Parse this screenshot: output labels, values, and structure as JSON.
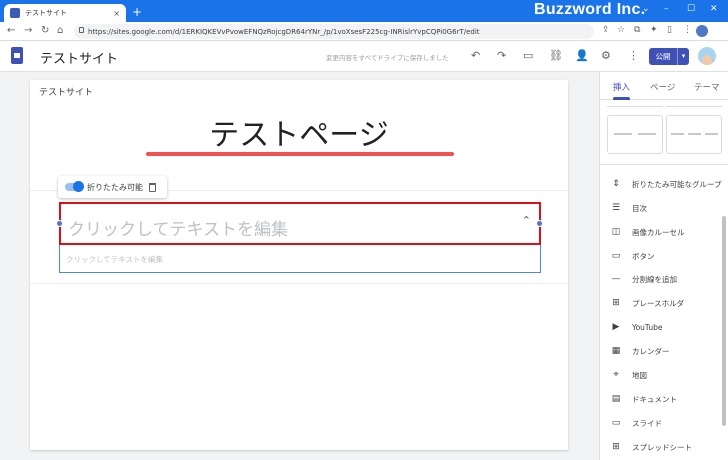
{
  "browser": {
    "tab_title": "テストサイト",
    "tab_close": "×",
    "new_tab": "+",
    "brand": "Buzzword Inc.",
    "window_controls": [
      "⌄",
      "–",
      "☐",
      "✕"
    ],
    "back": "←",
    "forward": "→",
    "reload": "↻",
    "home": "⌂",
    "url": "https://sites.google.com/d/1ERKIQKEVvPvowEFNQzRojcgDR64rYNr_/p/1voXsesF225cg-INRislrYvpCQPi0G6rT/edit",
    "toolbar_right_icons": [
      "⇪",
      "☆",
      "⧉",
      "✦",
      "▯"
    ],
    "menu": "⋮"
  },
  "appbar": {
    "site_name": "テストサイト",
    "save_status": "変更内容をすべてドライブに保存しました",
    "undo": "↶",
    "redo": "↷",
    "preview": "▭",
    "link": "⛓",
    "share": "👤",
    "settings": "⚙",
    "more": "⋮",
    "publish_label": "公開",
    "publish_dropdown": "▾"
  },
  "page": {
    "site_label": "テストサイト",
    "title": "テストページ",
    "chip_label": "折りたたみ可能",
    "collapse_header_placeholder": "クリックしてテキストを編集",
    "collapse_chevron": "⌃",
    "collapse_body_placeholder": "クリックしてテキストを編集"
  },
  "panel": {
    "tabs": [
      "挿入",
      "ページ",
      "テーマ"
    ],
    "active_tab": "挿入",
    "items": [
      {
        "icon": "collapsible-group-icon",
        "glyph": "⇕",
        "label": "折りたたみ可能なグループ"
      },
      {
        "icon": "toc-icon",
        "glyph": "☰",
        "label": "目次"
      },
      {
        "icon": "carousel-icon",
        "glyph": "◫",
        "label": "画像カルーセル"
      },
      {
        "icon": "button-icon",
        "glyph": "▭",
        "label": "ボタン"
      },
      {
        "icon": "divider-icon",
        "glyph": "—",
        "label": "分割線を追加"
      },
      {
        "icon": "placeholder-icon",
        "glyph": "⊞",
        "label": "プレースホルダ"
      },
      {
        "icon": "youtube-icon",
        "glyph": "▶",
        "label": "YouTube"
      },
      {
        "icon": "calendar-icon",
        "glyph": "▦",
        "label": "カレンダー"
      },
      {
        "icon": "map-pin-icon",
        "glyph": "⌖",
        "label": "地図"
      },
      {
        "icon": "docs-icon",
        "glyph": "▤",
        "label": "ドキュメント"
      },
      {
        "icon": "slides-icon",
        "glyph": "▭",
        "label": "スライド"
      },
      {
        "icon": "sheets-icon",
        "glyph": "⊞",
        "label": "スプレッドシート"
      }
    ]
  },
  "colors": {
    "chrome_blue": "#1a73e8",
    "sites_indigo": "#3f51b5",
    "highlight_red": "#d9101a",
    "underline_red": "#f25151"
  }
}
